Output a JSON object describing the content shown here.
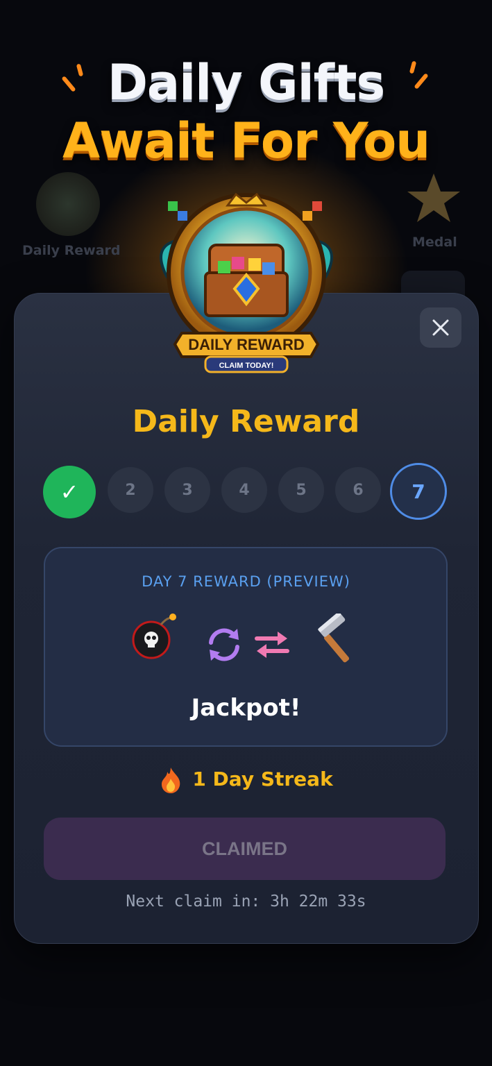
{
  "headline": {
    "line1": "Daily Gifts",
    "line2": "Await For You"
  },
  "background": {
    "left_label": "Daily Reward",
    "right_label": "Medal"
  },
  "emblem": {
    "banner": "DAILY REWARD",
    "sub": "CLAIM TODAY!"
  },
  "modal": {
    "title": "Daily Reward",
    "days": [
      {
        "label": "✓",
        "state": "claimed"
      },
      {
        "label": "2",
        "state": "locked"
      },
      {
        "label": "3",
        "state": "locked"
      },
      {
        "label": "4",
        "state": "locked"
      },
      {
        "label": "5",
        "state": "locked"
      },
      {
        "label": "6",
        "state": "locked"
      },
      {
        "label": "7",
        "state": "target"
      }
    ],
    "preview": {
      "label": "DAY 7 REWARD (PREVIEW)",
      "icons": [
        "bomb-icon",
        "refresh-icon",
        "swap-icon",
        "hammer-icon"
      ],
      "reward": "Jackpot!"
    },
    "streak": "1 Day Streak",
    "claim_button": "CLAIMED",
    "next_claim": "Next claim in: 3h 22m 33s"
  },
  "colors": {
    "accent_gold": "#f5b81a",
    "success": "#1fb55a",
    "target_blue": "#4f8ce6"
  }
}
